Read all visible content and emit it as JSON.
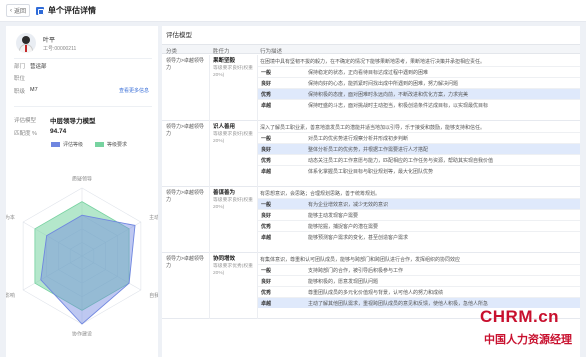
{
  "header": {
    "back_label": "返回",
    "title": "单个评估详情"
  },
  "employee": {
    "name": "叶平",
    "id_text": "工号:00000211",
    "dept_label": "部门",
    "dept_value": "营运部",
    "position_label": "职位",
    "position_value": "",
    "rank_label": "职级",
    "rank_value": "M7",
    "link_label": "查看更多信息"
  },
  "model": {
    "label": "评估模型",
    "value": "中层领导力模型",
    "match_label": "匹配度 %",
    "match_value": "94.74"
  },
  "radar_legend": {
    "eval": "评估等级",
    "req": "等级要求"
  },
  "radar_labels": [
    "质疑领导",
    "主动性",
    "自我激励",
    "协作建设",
    "沟通影响",
    "以人为本"
  ],
  "colors": {
    "eval": "#6f86e0",
    "req": "#77d3a0",
    "accent": "#2f6bd8"
  },
  "table": {
    "title": "评估模型",
    "headers": [
      "分类",
      "胜任力",
      "行为描述"
    ],
    "rows": [
      {
        "category": "领导力>卓越领导力",
        "name": "果断坚毅",
        "req": "等级要求良好(权重20%)",
        "desc": "在困境中具有坚韧不拔的毅力，在不确定的情况下能够果断地思考，果断地进行决策并承担相应责任。",
        "levels": [
          {
            "level": "一般",
            "text": "保持稳定的状态，正向看待目标达成过程中遇到的困难",
            "hl": false
          },
          {
            "level": "良好",
            "text": "保持向好的心态，能抓紧时间找出成中所遇到的困难，努力解决问题",
            "hl": false
          },
          {
            "level": "优秀",
            "text": "保持积极的态度，面对困难时永远向前，不断改进和优化方案，力求完美",
            "hl": true
          },
          {
            "level": "卓越",
            "text": "保持旺盛的斗志，面对挑战时主动担当，积极创造条件达成目标，以实现最优目标",
            "hl": false
          }
        ]
      },
      {
        "category": "领导力>卓越领导力",
        "name": "识人善用",
        "req": "等级要求良好(权重20%)",
        "desc": "深入了解员工职业素，善意地激发员工的潜能并适当地加以引导，乐于接受和鼓励，能够支持和信任。",
        "levels": [
          {
            "level": "一般",
            "text": "对员工的优劣势进行观察分析并形成初步判断",
            "hl": false
          },
          {
            "level": "良好",
            "text": "整体分析员工的优劣势，并根据工作需要进行人才搭配",
            "hl": true
          },
          {
            "level": "优秀",
            "text": "动态关注员工的工作意愿与能力，匹配相应的工作任务与资源，帮助其实现自我价值",
            "hl": false
          },
          {
            "level": "卓越",
            "text": "体系化掌握员工职业目标与职业规划等，最大化团队优势",
            "hl": false
          }
        ]
      },
      {
        "category": "领导力>卓越领导力",
        "name": "善谋善为",
        "req": "等级要求良好(权重20%)",
        "desc": "有思想意识，会思路；合理规划思路，善于统筹规划。",
        "levels": [
          {
            "level": "一般",
            "text": "有为企业增效意识，减少无效的意识",
            "hl": true
          },
          {
            "level": "良好",
            "text": "能够主动发现客户需要",
            "hl": false
          },
          {
            "level": "优秀",
            "text": "能够挖掘，捕捉客户的潜在需要",
            "hl": false
          },
          {
            "level": "卓越",
            "text": "能够预测客户需求的变化，甚至创造客户需求",
            "hl": false
          }
        ]
      },
      {
        "category": "领导力>卓越领导力",
        "name": "协同增效",
        "req": "等级要求优秀(权重20%)",
        "desc": "有集体意识，尊重和认可团队成员，能够与跨部门和跨团队进行合作，发挥组织的协同效应",
        "levels": [
          {
            "level": "一般",
            "text": "支持跨部门的合作，被引导后积极参与工作",
            "hl": false
          },
          {
            "level": "良好",
            "text": "能够积极的，愿意发现团队问题",
            "hl": false
          },
          {
            "level": "优秀",
            "text": "尊重团队成员的多元化价值观与背景，认可他人的努力和成绩",
            "hl": false
          },
          {
            "level": "卓越",
            "text": "主动了解其他团队需求，重视跨团队成员的意见和反馈，使他人积极，急他人所急",
            "hl": true
          }
        ]
      }
    ]
  },
  "watermark": {
    "big": "CHRM.cn",
    "small": "中国人力资源经理"
  }
}
